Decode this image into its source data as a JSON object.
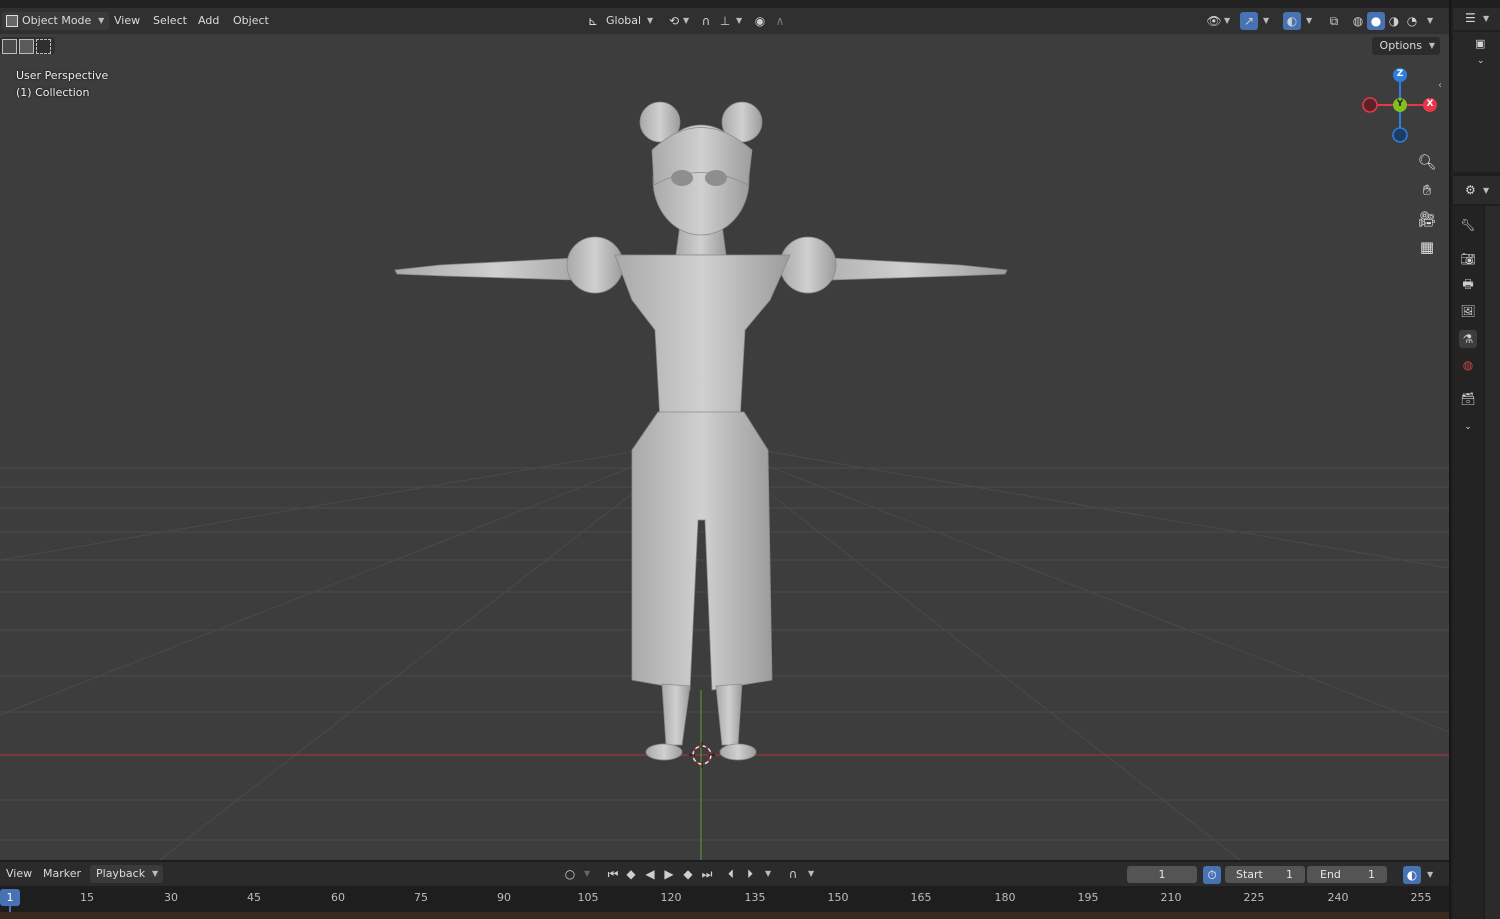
{
  "header": {
    "mode_label": "Object Mode",
    "menu": [
      "View",
      "Select",
      "Add",
      "Object"
    ],
    "transform_orientation": "Global"
  },
  "viewport": {
    "perspective_label": "User Perspective",
    "collection_label": "(1) Collection",
    "options_label": "Options"
  },
  "gizmo": {
    "x_label": "X",
    "y_label": "Y",
    "z_label": "Z"
  },
  "timeline": {
    "menu": [
      "View",
      "Marker",
      "Playback"
    ],
    "current_frame": "1",
    "start_label": "Start",
    "start_value": "1",
    "end_label": "End",
    "end_value": "1",
    "ruler_marker": "1",
    "ruler_ticks": [
      "15",
      "30",
      "45",
      "60",
      "75",
      "90",
      "105",
      "120",
      "135",
      "150",
      "165",
      "180",
      "195",
      "210",
      "225",
      "240",
      "255"
    ]
  },
  "colors": {
    "axis_x": "#e8374b",
    "axis_y": "#7fbf1f",
    "axis_z": "#2f7fe0",
    "accent": "#4772b3",
    "floor_red_line": "#b3343f",
    "floor_green_line": "#5d9e2e"
  }
}
